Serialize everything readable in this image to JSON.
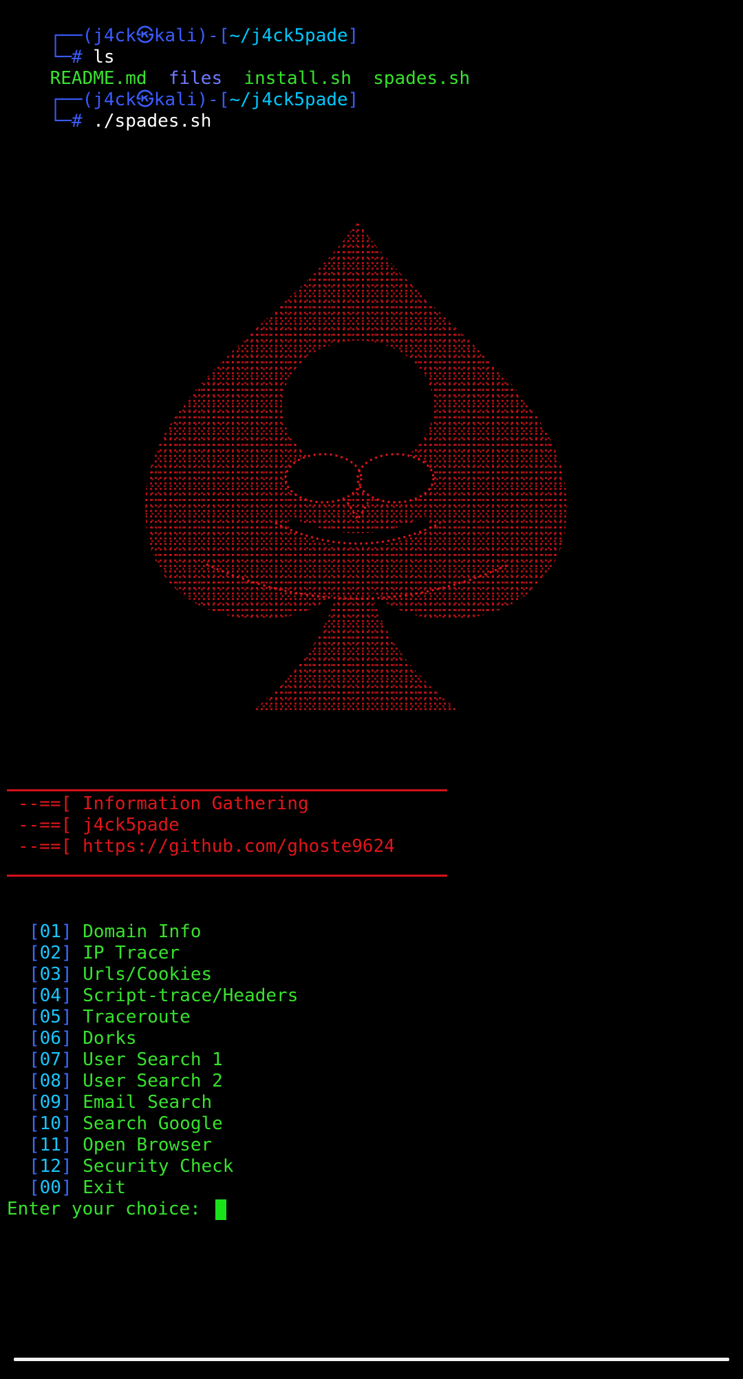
{
  "prompt": {
    "user": "j4ck",
    "host": "kali",
    "path": "~/j4ck5pade",
    "symbol": "#"
  },
  "commands": [
    "ls",
    "./spades.sh"
  ],
  "ls_output": [
    "README.md",
    "files",
    "install.sh",
    "spades.sh"
  ],
  "banner": {
    "prefix": "--==[",
    "lines": [
      "Information Gathering",
      "j4ck5pade",
      "https://github.com/ghoste9624"
    ]
  },
  "menu": [
    {
      "num": "01",
      "label": "Domain Info"
    },
    {
      "num": "02",
      "label": "IP Tracer"
    },
    {
      "num": "03",
      "label": "Urls/Cookies"
    },
    {
      "num": "04",
      "label": "Script-trace/Headers"
    },
    {
      "num": "05",
      "label": "Traceroute"
    },
    {
      "num": "06",
      "label": "Dorks"
    },
    {
      "num": "07",
      "label": "User Search 1"
    },
    {
      "num": "08",
      "label": "User Search 2"
    },
    {
      "num": "09",
      "label": "Email Search"
    },
    {
      "num": "10",
      "label": "Search Google"
    },
    {
      "num": "11",
      "label": "Open Browser"
    },
    {
      "num": "12",
      "label": "Security Check"
    },
    {
      "num": "00",
      "label": "Exit"
    }
  ],
  "input_prompt": "Enter your choice: ",
  "colors": {
    "art": "#e0161a",
    "menu_text": "#38e22e",
    "cursor": "#19e219"
  }
}
